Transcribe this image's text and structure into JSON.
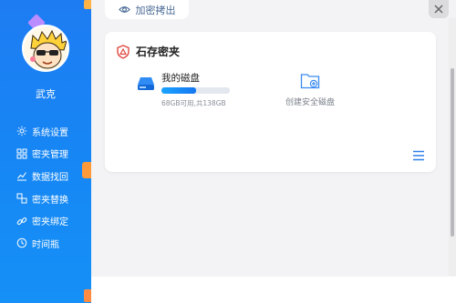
{
  "user": {
    "name": "武克"
  },
  "menu": [
    {
      "label": "系统设置",
      "icon": "gear-icon"
    },
    {
      "label": "密夹管理",
      "icon": "grid-icon"
    },
    {
      "label": "数据找回",
      "icon": "chart-icon"
    },
    {
      "label": "密夹替换",
      "icon": "swap-icon"
    },
    {
      "label": "密夹绑定",
      "icon": "link-icon"
    },
    {
      "label": "时间瓶",
      "icon": "clock-icon"
    }
  ],
  "toolbar": {
    "export_label": "加密拷出"
  },
  "vault": {
    "title": "石存密夹",
    "disk": {
      "name": "我的磁盘",
      "usage": "68GB可用,共138GB",
      "used_fraction": 0.51
    },
    "create_label": "创建安全磁盘"
  },
  "colors": {
    "sidebar": "#1e7cf2",
    "accent": "#1577f0",
    "vault_icon": "#e0483f"
  }
}
